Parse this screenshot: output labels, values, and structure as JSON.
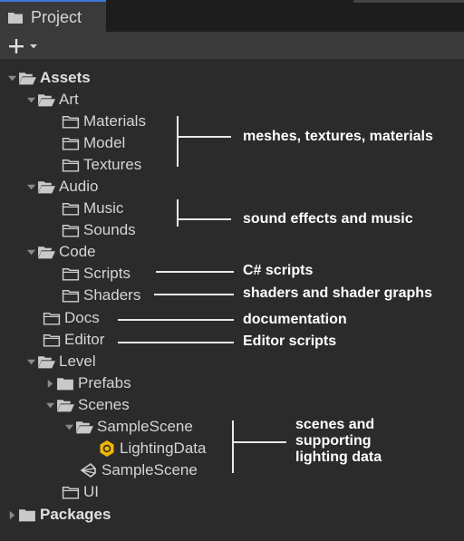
{
  "tab": {
    "label": "Project"
  },
  "toolbar": {
    "add_icon": "plus-icon",
    "dropdown_icon": "caret-down-icon"
  },
  "tree": {
    "assets": "Assets",
    "art": "Art",
    "materials": "Materials",
    "model": "Model",
    "textures": "Textures",
    "audio": "Audio",
    "music": "Music",
    "sounds": "Sounds",
    "code": "Code",
    "scripts": "Scripts",
    "shaders": "Shaders",
    "docs": "Docs",
    "editor": "Editor",
    "level": "Level",
    "prefabs": "Prefabs",
    "scenes": "Scenes",
    "samplescene_folder": "SampleScene",
    "lightingdata": "LightingData",
    "samplescene_file": "SampleScene",
    "ui": "UI",
    "packages": "Packages"
  },
  "annotations": {
    "art": "meshes, textures, materials",
    "audio": "sound effects and music",
    "scripts": "C# scripts",
    "shaders": "shaders and shader graphs",
    "docs": "documentation",
    "editor": "Editor scripts",
    "scenes_line1": "scenes and",
    "scenes_line2": "supporting",
    "scenes_line3": "lighting data"
  },
  "colors": {
    "accent": "#3c78d8",
    "lighting_icon": "#f0b400"
  }
}
